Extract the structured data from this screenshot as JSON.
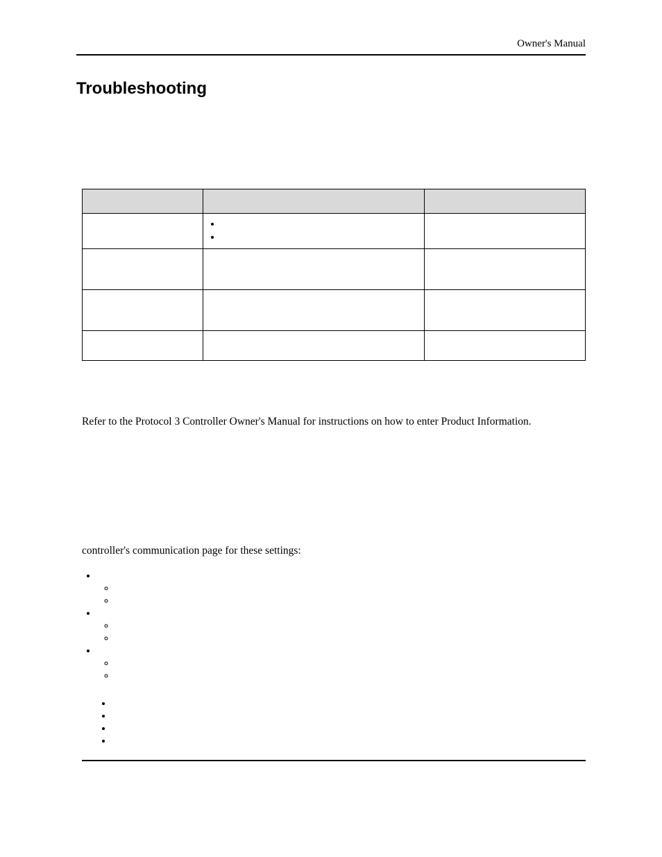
{
  "header": {
    "right": "Owner's Manual"
  },
  "title": "Troubleshooting",
  "table": {
    "headers": [
      "",
      "",
      ""
    ],
    "rows": [
      {
        "cells": [
          "",
          "<ul class='inner-bullets'><li>&nbsp;</li><li>&nbsp;</li></ul>",
          ""
        ]
      },
      {
        "cells": [
          "",
          "",
          ""
        ],
        "class": "row-med"
      },
      {
        "cells": [
          "",
          "",
          ""
        ],
        "class": "row-med"
      },
      {
        "cells": [
          "",
          "",
          ""
        ],
        "class": "row-short"
      }
    ]
  },
  "paragraph1": "Refer to the Protocol 3 Controller Owner's Manual for instructions on how to enter Product Information.",
  "paragraph2": "controller's communication page for these settings:",
  "list1": [
    {
      "text": "",
      "children": [
        "",
        ""
      ]
    },
    {
      "text": "",
      "children": [
        "",
        ""
      ]
    },
    {
      "text": "",
      "children": [
        "",
        ""
      ]
    }
  ],
  "list2": [
    "",
    "",
    "",
    ""
  ]
}
